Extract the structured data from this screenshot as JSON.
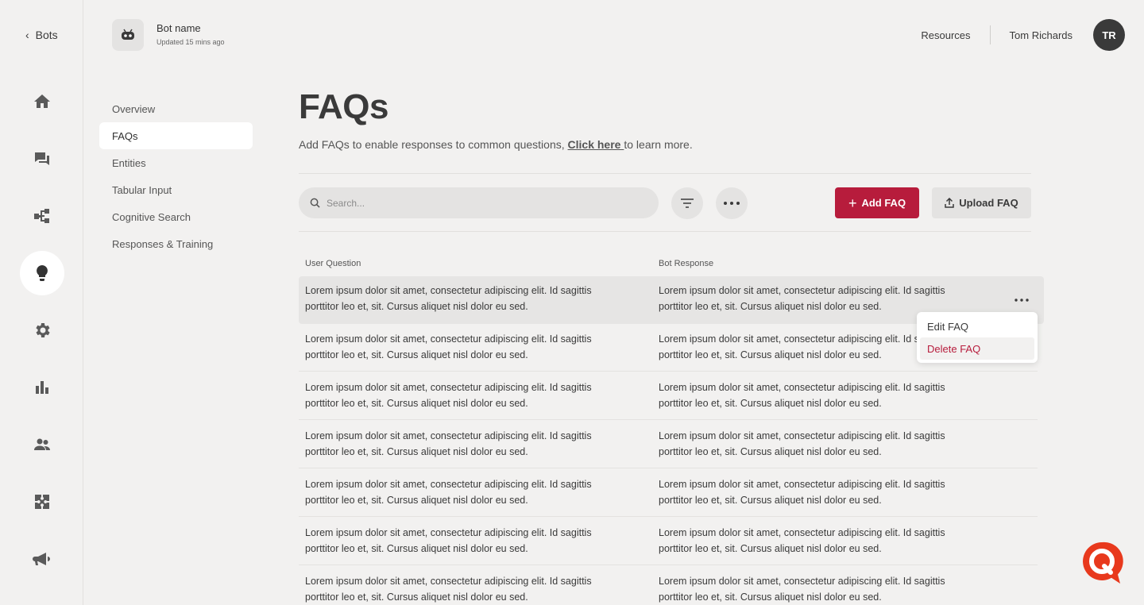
{
  "nav": {
    "back_label": "Bots",
    "rail_icons": [
      "home-icon",
      "chat-icon",
      "flow-icon",
      "lightbulb-icon",
      "gear-icon",
      "bar-chart-icon",
      "users-icon",
      "puzzle-icon",
      "megaphone-icon"
    ],
    "active_icon": "lightbulb-icon"
  },
  "header": {
    "bot_name": "Bot name",
    "updated": "Updated 15 mins ago",
    "resources": "Resources",
    "user_name": "Tom Richards",
    "user_initials": "TR"
  },
  "subnav": {
    "items": [
      {
        "label": "Overview"
      },
      {
        "label": "FAQs",
        "active": true
      },
      {
        "label": "Entities"
      },
      {
        "label": "Tabular Input"
      },
      {
        "label": "Cognitive Search"
      },
      {
        "label": "Responses & Training"
      }
    ]
  },
  "page": {
    "title": "FAQs",
    "desc_before": "Add FAQs to enable responses to common questions, ",
    "desc_link": "Click here ",
    "desc_after": "to learn more."
  },
  "toolbar": {
    "search_placeholder": "Search...",
    "add_label": "Add FAQ",
    "upload_label": "Upload FAQ"
  },
  "table": {
    "headers": {
      "question": "User Question",
      "response": "Bot Response"
    },
    "rows": [
      {
        "q": "Lorem ipsum dolor sit amet, consectetur adipiscing elit. Id sagittis porttitor leo et, sit. Cursus aliquet nisl dolor eu sed.",
        "r": "Lorem ipsum dolor sit amet, consectetur adipiscing elit. Id sagittis porttitor leo et, sit. Cursus aliquet nisl dolor eu sed."
      },
      {
        "q": "Lorem ipsum dolor sit amet, consectetur adipiscing elit. Id sagittis porttitor leo et, sit. Cursus aliquet nisl dolor eu sed.",
        "r": "Lorem ipsum dolor sit amet, consectetur adipiscing elit. Id sagittis porttitor leo et, sit. Cursus aliquet nisl dolor eu sed."
      },
      {
        "q": "Lorem ipsum dolor sit amet, consectetur adipiscing elit. Id sagittis porttitor leo et, sit. Cursus aliquet nisl dolor eu sed.",
        "r": "Lorem ipsum dolor sit amet, consectetur adipiscing elit. Id sagittis porttitor leo et, sit. Cursus aliquet nisl dolor eu sed."
      },
      {
        "q": "Lorem ipsum dolor sit amet, consectetur adipiscing elit. Id sagittis porttitor leo et, sit. Cursus aliquet nisl dolor eu sed.",
        "r": "Lorem ipsum dolor sit amet, consectetur adipiscing elit. Id sagittis porttitor leo et, sit. Cursus aliquet nisl dolor eu sed."
      },
      {
        "q": "Lorem ipsum dolor sit amet, consectetur adipiscing elit. Id sagittis porttitor leo et, sit. Cursus aliquet nisl dolor eu sed.",
        "r": "Lorem ipsum dolor sit amet, consectetur adipiscing elit. Id sagittis porttitor leo et, sit. Cursus aliquet nisl dolor eu sed."
      },
      {
        "q": "Lorem ipsum dolor sit amet, consectetur adipiscing elit. Id sagittis porttitor leo et, sit. Cursus aliquet nisl dolor eu sed.",
        "r": "Lorem ipsum dolor sit amet, consectetur adipiscing elit. Id sagittis porttitor leo et, sit. Cursus aliquet nisl dolor eu sed."
      },
      {
        "q": "Lorem ipsum dolor sit amet, consectetur adipiscing elit. Id sagittis porttitor leo et, sit. Cursus aliquet nisl dolor eu sed.",
        "r": "Lorem ipsum dolor sit amet, consectetur adipiscing elit. Id sagittis porttitor leo et, sit. Cursus aliquet nisl dolor eu sed."
      }
    ]
  },
  "row_menu": {
    "edit_label": "Edit FAQ",
    "delete_label": "Delete FAQ"
  },
  "colors": {
    "accent": "#b71c3c",
    "background": "#f2f1f0",
    "fab": "#e8391d"
  }
}
